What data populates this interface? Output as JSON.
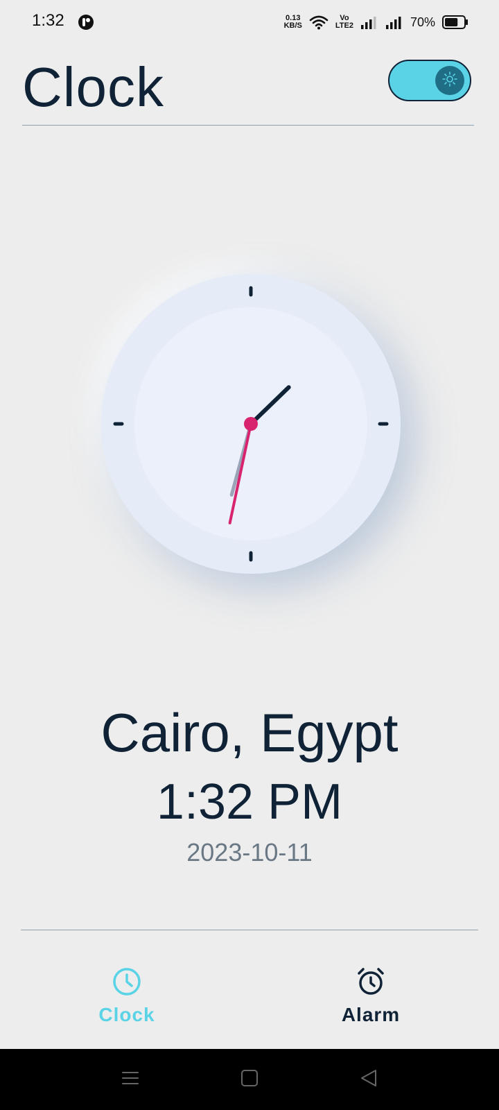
{
  "status_bar": {
    "time": "1:32",
    "net_speed_value": "0.13",
    "net_speed_unit": "KB/S",
    "volte_top": "Vo",
    "volte_bottom": "LTE2",
    "battery_percent": "70%",
    "battery_level": 0.7,
    "icons": [
      "app-notification-icon",
      "wifi-icon",
      "volte-icon",
      "signal-icon",
      "signal-icon",
      "battery-icon"
    ]
  },
  "header": {
    "title": "Clock",
    "theme_toggle": {
      "state": "light",
      "left_icon": "moon-icon",
      "right_icon": "sun-icon"
    }
  },
  "clock": {
    "hour": 1,
    "minute": 32,
    "second": 32,
    "colors": {
      "face_outer": "#e5ecf7",
      "face_inner": "#ebf0fa",
      "hour_hand": "#0f2236",
      "minute_hand": "#9aa3b8",
      "second_hand": "#d8246e"
    }
  },
  "location": {
    "city": "Cairo, Egypt",
    "time": "1:32 PM",
    "date": "2023-10-11"
  },
  "bottom_nav": {
    "active": "clock",
    "items": [
      {
        "id": "clock",
        "label": "Clock",
        "icon": "clock-icon"
      },
      {
        "id": "alarm",
        "label": "Alarm",
        "icon": "alarm-icon"
      }
    ]
  },
  "colors": {
    "background": "#ededed",
    "primary_text": "#0f2236",
    "accent": "#5ad3e6",
    "divider": "#8da4b2",
    "secondary_text": "#6a7885"
  }
}
